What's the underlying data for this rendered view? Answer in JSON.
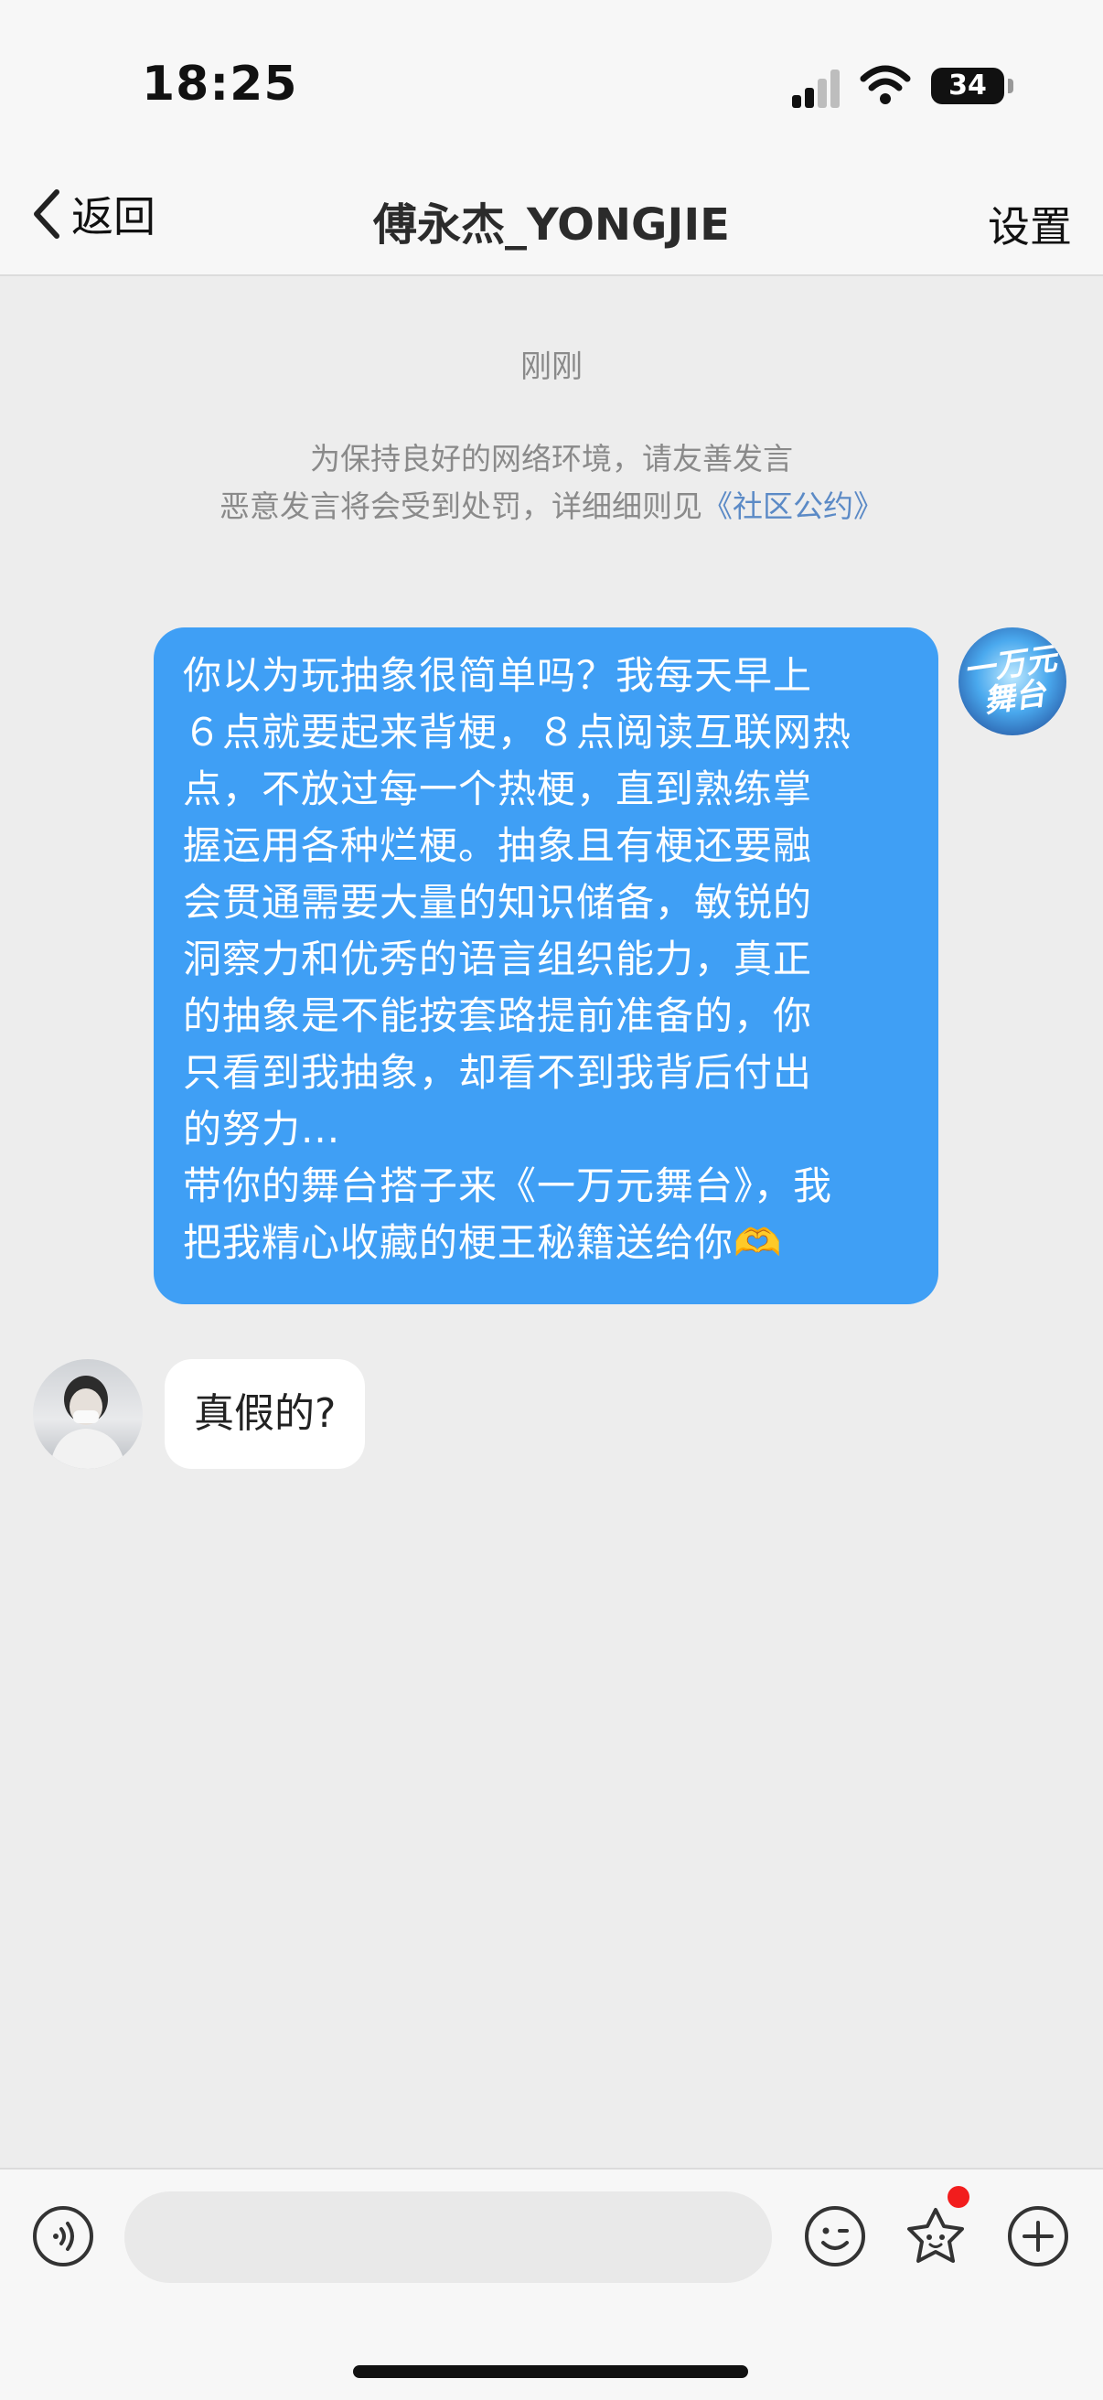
{
  "status_bar": {
    "time": "18:25",
    "battery": "34"
  },
  "nav": {
    "back_label": "返回",
    "title": "傅永杰_YONGJIE",
    "settings_label": "设置"
  },
  "chat": {
    "timestamp": "刚刚",
    "notice_line1": "为保持良好的网络环境，请友善发言",
    "notice_line2_prefix": "恶意发言将会受到处罚，详细细则见",
    "notice_link": "《社区公约》",
    "outgoing_message": "你以为玩抽象很简单吗？我每天早上\n６点就要起来背梗，８点阅读互联网热\n点，不放过每一个热梗，直到熟练掌\n握运用各种烂梗。抽象且有梗还要融\n会贯通需要大量的知识储备，敏锐的\n洞察力和优秀的语言组织能力，真正\n的抽象是不能按套路提前准备的，你\n只看到我抽象，却看不到我背后付出\n的努力...\n带你的舞台搭子来《一万元舞台》，我\n把我精心收藏的梗王秘籍送给你🫶",
    "outgoing_avatar_text": "一万元舞台",
    "incoming_message": "真假的?"
  },
  "input_bar": {
    "icons": [
      "voice-icon",
      "emoji-icon",
      "sticker-icon",
      "plus-icon"
    ],
    "badge_color": "#f21d1d"
  },
  "colors": {
    "bubble_out": "#3f9ff5",
    "link": "#5b8ac6",
    "background": "#ededed"
  }
}
